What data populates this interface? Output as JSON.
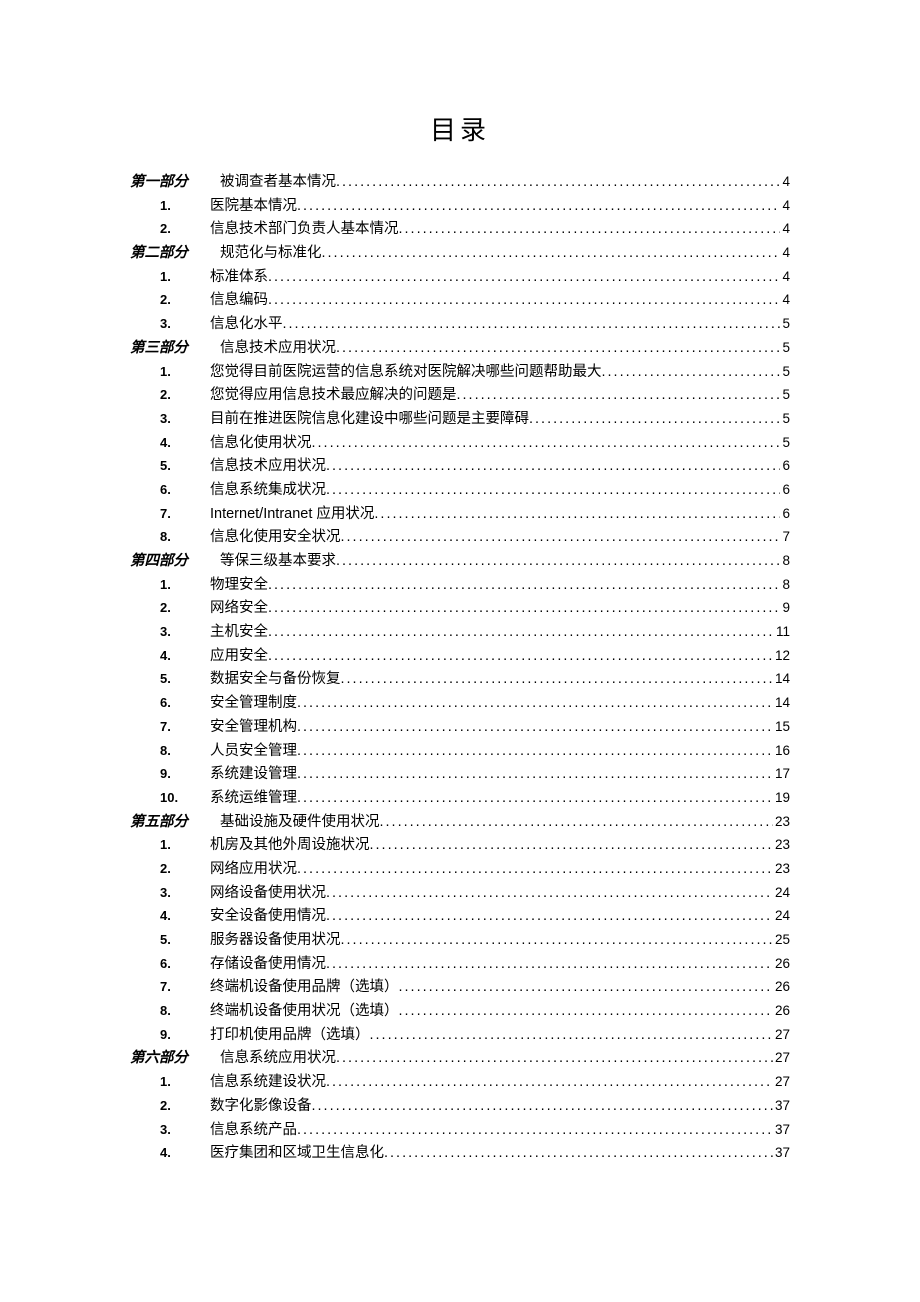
{
  "title": "目录",
  "entries": [
    {
      "type": "section",
      "num": "第一部分",
      "label": "被调查者基本情况",
      "page": "4"
    },
    {
      "type": "item",
      "num": "1.",
      "label": "医院基本情况",
      "page": "4"
    },
    {
      "type": "item",
      "num": "2.",
      "label": "信息技术部门负责人基本情况",
      "page": "4"
    },
    {
      "type": "section",
      "num": "第二部分",
      "label": "规范化与标准化",
      "page": "4"
    },
    {
      "type": "item",
      "num": "1.",
      "label": "标准体系",
      "page": "4"
    },
    {
      "type": "item",
      "num": "2.",
      "label": "信息编码",
      "page": "4"
    },
    {
      "type": "item",
      "num": "3.",
      "label": "信息化水平",
      "page": "5"
    },
    {
      "type": "section",
      "num": "第三部分",
      "label": "信息技术应用状况",
      "page": "5"
    },
    {
      "type": "item",
      "num": "1.",
      "label": "您觉得目前医院运营的信息系统对医院解决哪些问题帮助最大",
      "page": "5"
    },
    {
      "type": "item",
      "num": "2.",
      "label": "您觉得应用信息技术最应解决的问题是",
      "page": "5"
    },
    {
      "type": "item",
      "num": "3.",
      "label": "目前在推进医院信息化建设中哪些问题是主要障碍",
      "page": "5"
    },
    {
      "type": "item",
      "num": "4.",
      "label": "信息化使用状况",
      "page": "5"
    },
    {
      "type": "item",
      "num": "5.",
      "label": "信息技术应用状况",
      "page": "6"
    },
    {
      "type": "item",
      "num": "6.",
      "label": "信息系统集成状况",
      "page": "6"
    },
    {
      "type": "item",
      "num": "7.",
      "label": "Internet/Intranet 应用状况",
      "page": "6",
      "latin": true
    },
    {
      "type": "item",
      "num": "8.",
      "label": "信息化使用安全状况",
      "page": "7"
    },
    {
      "type": "section",
      "num": "第四部分",
      "label": "等保三级基本要求",
      "page": "8"
    },
    {
      "type": "item",
      "num": "1.",
      "label": "物理安全",
      "page": "8"
    },
    {
      "type": "item",
      "num": "2.",
      "label": "网络安全",
      "page": "9"
    },
    {
      "type": "item",
      "num": "3.",
      "label": "主机安全",
      "page": "11"
    },
    {
      "type": "item",
      "num": "4.",
      "label": "应用安全",
      "page": "12"
    },
    {
      "type": "item",
      "num": "5.",
      "label": "数据安全与备份恢复",
      "page": "14"
    },
    {
      "type": "item",
      "num": "6.",
      "label": "安全管理制度",
      "page": "14"
    },
    {
      "type": "item",
      "num": "7.",
      "label": "安全管理机构",
      "page": "15"
    },
    {
      "type": "item",
      "num": "8.",
      "label": "人员安全管理",
      "page": "16"
    },
    {
      "type": "item",
      "num": "9.",
      "label": "系统建设管理",
      "page": "17"
    },
    {
      "type": "item",
      "num": "10.",
      "label": "系统运维管理",
      "page": "19"
    },
    {
      "type": "section",
      "num": "第五部分",
      "label": "基础设施及硬件使用状况",
      "page": "23"
    },
    {
      "type": "item",
      "num": "1.",
      "label": "机房及其他外周设施状况",
      "page": "23"
    },
    {
      "type": "item",
      "num": "2.",
      "label": "网络应用状况",
      "page": "23"
    },
    {
      "type": "item",
      "num": "3.",
      "label": "网络设备使用状况",
      "page": "24"
    },
    {
      "type": "item",
      "num": "4.",
      "label": "安全设备使用情况",
      "page": "24"
    },
    {
      "type": "item",
      "num": "5.",
      "label": "服务器设备使用状况",
      "page": "25"
    },
    {
      "type": "item",
      "num": "6.",
      "label": "存储设备使用情况",
      "page": "26"
    },
    {
      "type": "item",
      "num": "7.",
      "label": "终端机设备使用品牌（选填）",
      "page": "26"
    },
    {
      "type": "item",
      "num": "8.",
      "label": "终端机设备使用状况（选填）",
      "page": "26"
    },
    {
      "type": "item",
      "num": "9.",
      "label": "打印机使用品牌（选填）",
      "page": "27"
    },
    {
      "type": "section",
      "num": "第六部分",
      "label": "信息系统应用状况",
      "page": "27"
    },
    {
      "type": "item",
      "num": "1.",
      "label": "信息系统建设状况",
      "page": "27"
    },
    {
      "type": "item",
      "num": "2.",
      "label": "数字化影像设备",
      "page": "37"
    },
    {
      "type": "item",
      "num": "3.",
      "label": "信息系统产品",
      "page": "37"
    },
    {
      "type": "item",
      "num": "4.",
      "label": "医疗集团和区域卫生信息化",
      "page": "37"
    }
  ]
}
